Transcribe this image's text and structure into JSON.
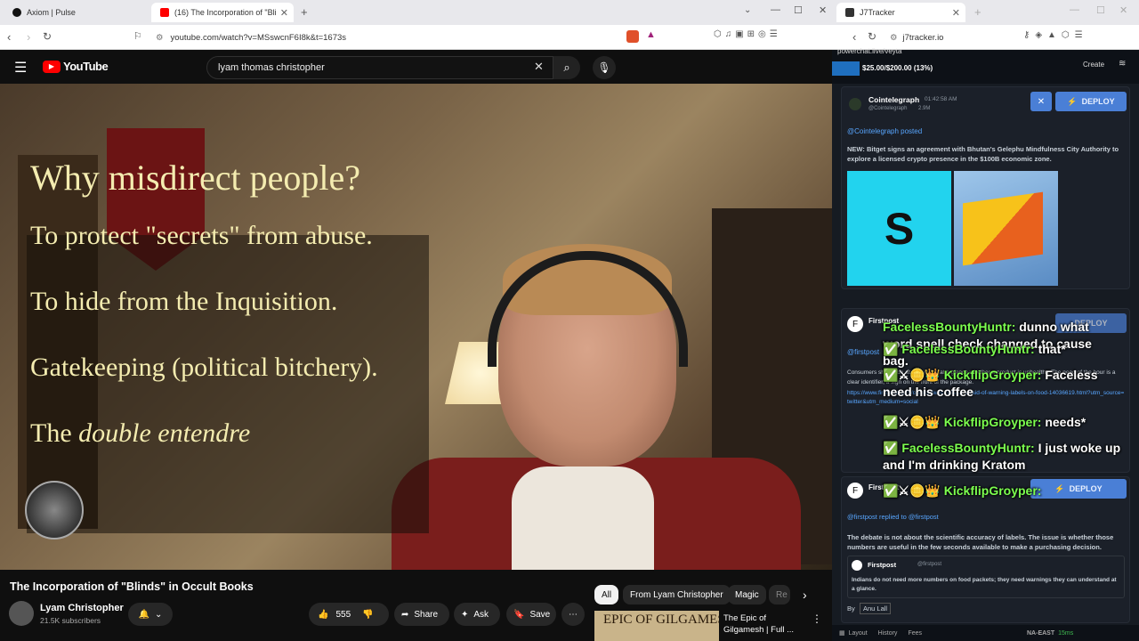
{
  "tabs": {
    "tab1": "Axiom | Pulse",
    "tab2": "(16) The Incorporation of \"Bli",
    "tab3": "J7Tracker"
  },
  "address": {
    "left_url": "youtube.com/watch?v=MSswcnF6I8k&t=1673s",
    "right_url": "j7tracker.io"
  },
  "youtube": {
    "brand": "YouTube",
    "search_value": "lyam thomas christopher",
    "video_lines": [
      "Why misdirect people?",
      "To protect \"secrets\" from abuse.",
      "To hide from the Inquisition.",
      "Gatekeeping (political bitchery).",
      "The ",
      "double entendre"
    ],
    "title": "The Incorporation of \"Blinds\" in Occult Books",
    "channel": "Lyam Christopher",
    "subscribers": "21.5K subscribers",
    "likes": "555",
    "share": "Share",
    "ask": "Ask",
    "save": "Save",
    "chips": [
      "All",
      "From Lyam Christopher",
      "Magic",
      "Re"
    ],
    "rec_title": "The Epic of Gilgamesh | Full ...",
    "rec_thumb": "EPIC OF GILGAMESH"
  },
  "tracker": {
    "powerchat": "powerchat.live/veyta",
    "budget": "$25.00/$200.00 (13%)",
    "budget_progress": 0.13,
    "create": "Create",
    "post1": {
      "account": "Cointelegraph",
      "handle": "@Cointelegraph",
      "time": "01:42:58 AM",
      "followers": "2.9M",
      "posted": "@Cointelegraph posted",
      "text": "NEW: Bitget signs an agreement with Bhutan's Gelephu Mindfulness City Authority to explore a licensed crypto presence in the $100B economic zone."
    },
    "deploy": "DEPLOY",
    "post2": {
      "account": "Firstpost",
      "posted": "@firstpost",
      "text": "Consumers should be able to judge at a glance whether a product is unhealthy. The need of the hour is a clear identifier, a sign on the front of the package.",
      "link": "https://www.firstpost.com/opinion/why-is-fssai-afraid-of-warning-labels-on-food-14036619.html?utm_source=twitter&utm_medium=social"
    },
    "post3": {
      "account": "Firstpost",
      "replied": "@firstpost replied to @firstpost",
      "text1": "The debate is not about the scientific accuracy of labels. The issue is whether those numbers are useful in the few seconds available to make a purchasing decision.",
      "quote_account": "Firstpost",
      "quote_handle": "@firstpost",
      "quote_text": "Indians do not need more numbers on food packets; they need warnings they can understand at a glance.",
      "by": "By",
      "author": "Anu Lall"
    },
    "bottom": {
      "layout": "Layout",
      "history": "History",
      "fees": "Fees",
      "region": "NA-EAST",
      "ping": "15ms"
    }
  },
  "chat": [
    {
      "name": "FacelessBountyHuntr:",
      "msg": "dunno what word spell check changed to cause bag."
    },
    {
      "name": "FacelessBountyHuntr:",
      "msg": "that*"
    },
    {
      "name": "KickflipGroyper:",
      "msg": "Faceless need his coffee"
    },
    {
      "name": "KickflipGroyper:",
      "msg": "needs*"
    },
    {
      "name": "FacelessBountyHuntr:",
      "msg": "I just woke up and I'm drinking Kratom"
    },
    {
      "name": "KickflipGroyper:",
      "msg": ""
    }
  ],
  "colors": {
    "yt_red": "#ff0000",
    "deploy_blue": "#4a7fd6",
    "chat_green": "#7cff4f",
    "overlay_text": "#f4ecb0"
  }
}
